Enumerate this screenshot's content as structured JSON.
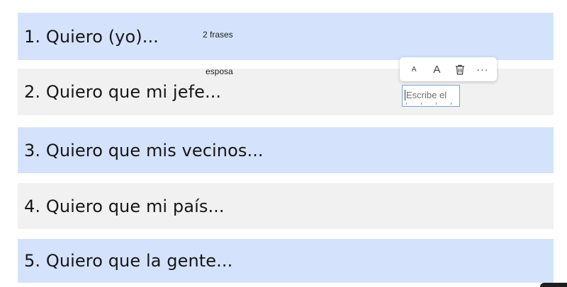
{
  "rows": [
    {
      "label": "1. Quiero (yo)..."
    },
    {
      "label": "2. Quiero que mi jefe..."
    },
    {
      "label": "3. Quiero que mis vecinos..."
    },
    {
      "label": "4. Quiero que mi país..."
    },
    {
      "label": "5. Quiero que la gente..."
    }
  ],
  "notes": {
    "first": "2 frases",
    "second": "esposa"
  },
  "toolbar": {
    "decrease_font_label": "A",
    "increase_font_label": "A",
    "delete_icon": "trash-icon",
    "more_label": "···"
  },
  "textbox": {
    "value": "Escribe el"
  },
  "colors": {
    "row_blue": "#d4e2fc",
    "row_gray": "#f1f1f1",
    "textbox_border": "#7aa3d2"
  }
}
